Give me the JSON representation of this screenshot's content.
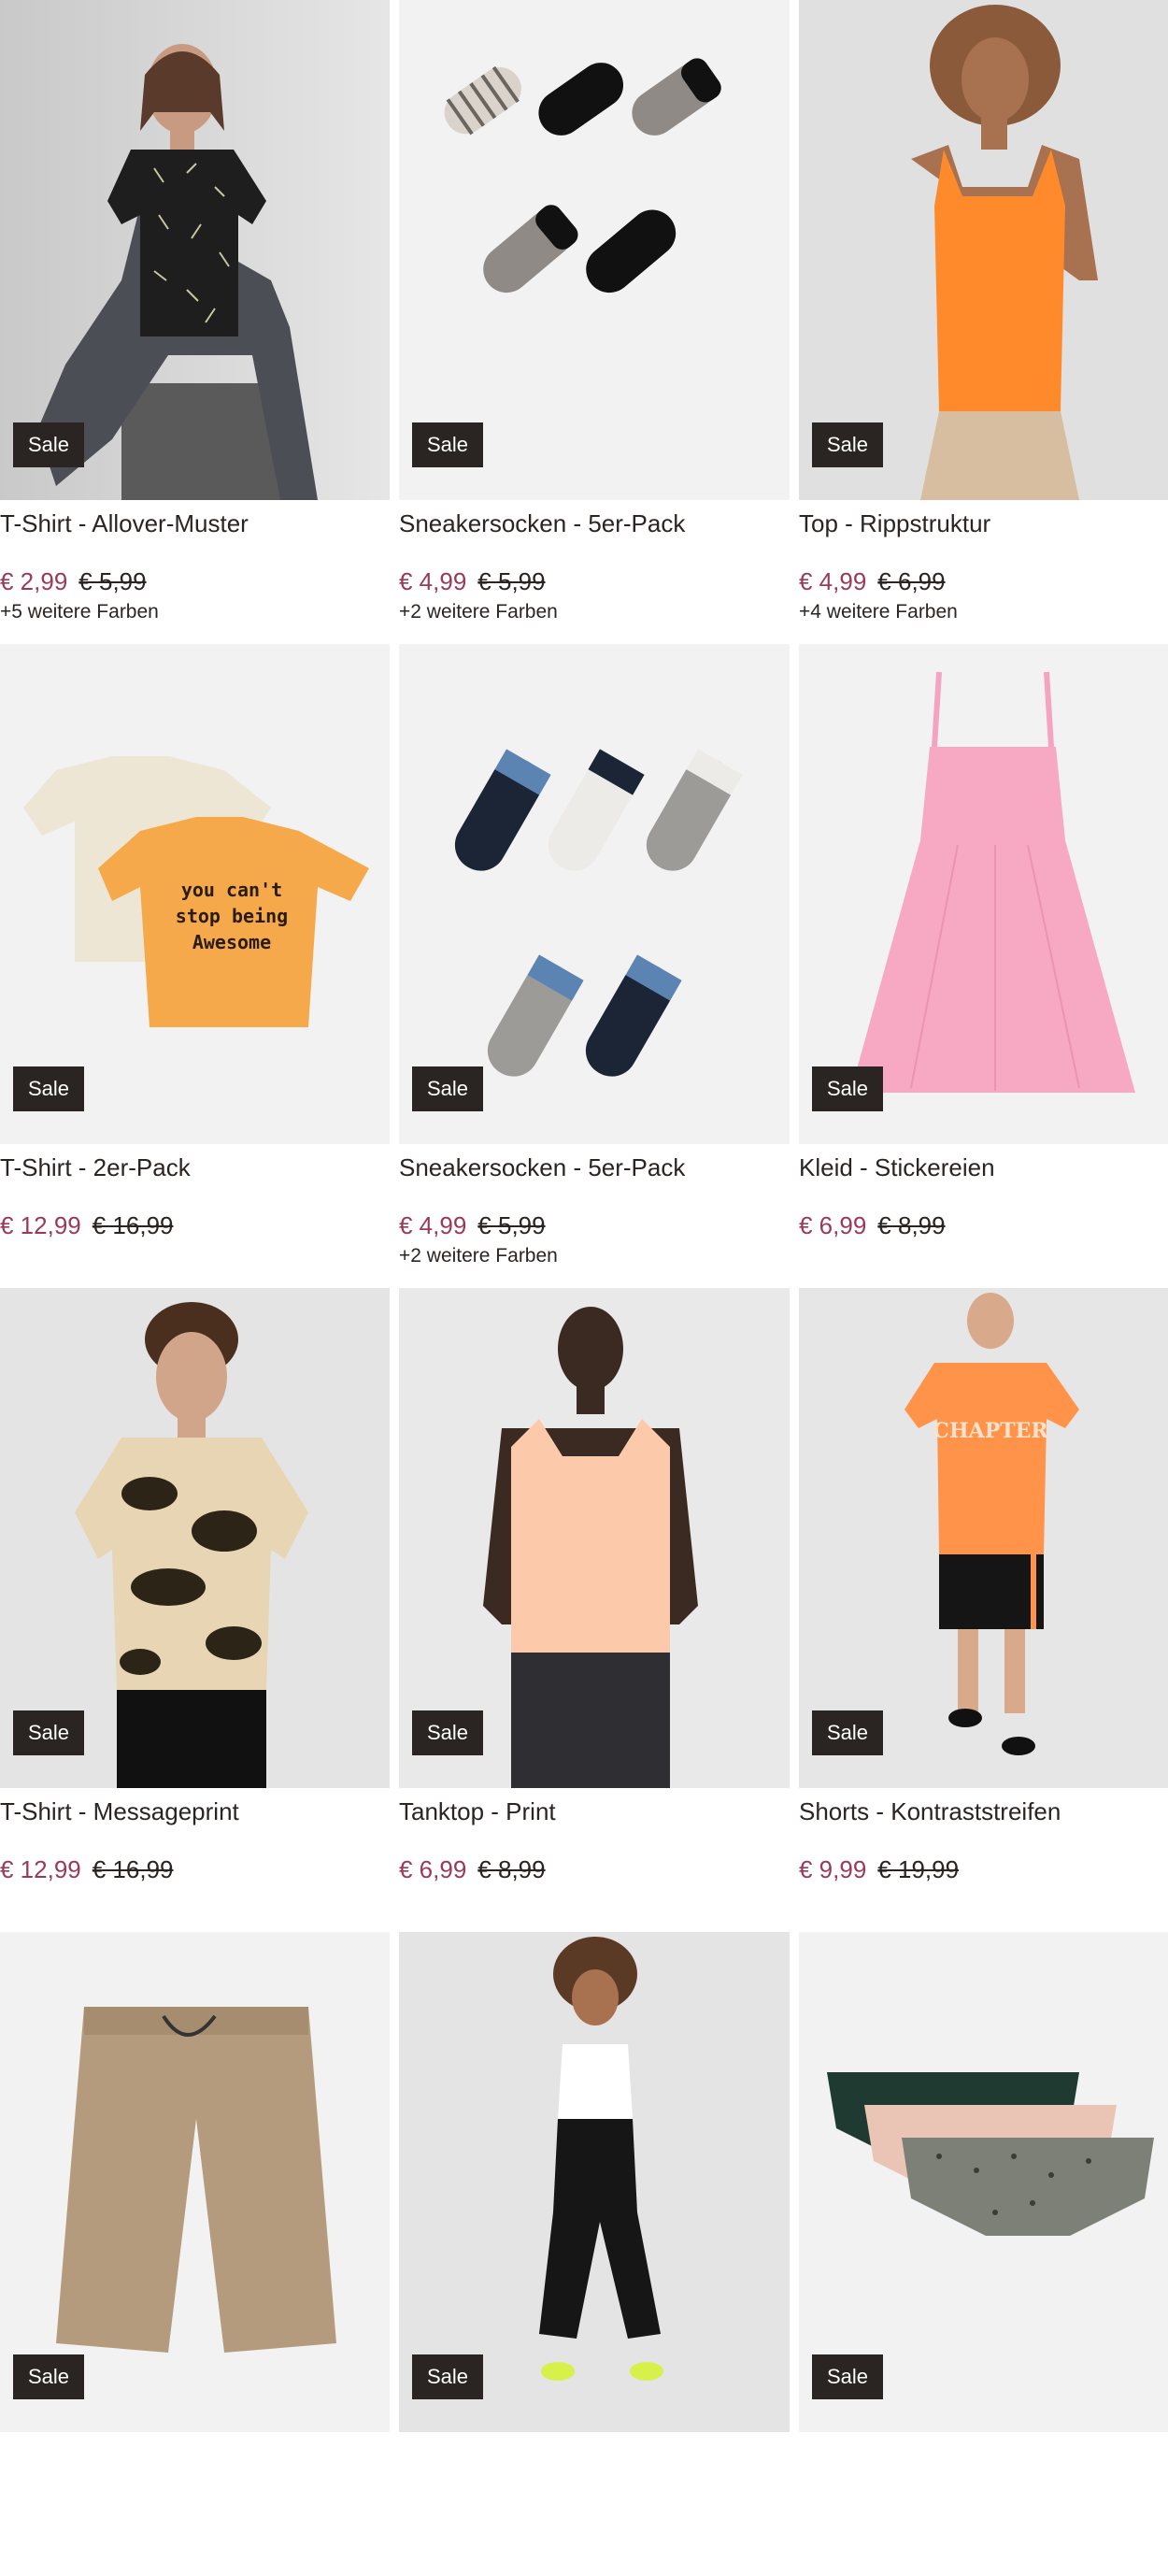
{
  "sale_label": "Sale",
  "products": [
    {
      "title": "T-Shirt - Allover-Muster",
      "price": "€ 2,99",
      "old_price": "€ 5,99",
      "colors": "+5 weitere Farben",
      "icon": "tshirt-allover-pattern-photo"
    },
    {
      "title": "Sneakersocken - 5er-Pack",
      "price": "€ 4,99",
      "old_price": "€ 5,99",
      "colors": "+2 weitere Farben",
      "icon": "gaming-socks-photo"
    },
    {
      "title": "Top - Rippstruktur",
      "price": "€ 4,99",
      "old_price": "€ 6,99",
      "colors": "+4 weitere Farben",
      "icon": "orange-top-photo"
    },
    {
      "title": "T-Shirt - 2er-Pack",
      "price": "€ 12,99",
      "old_price": "€ 16,99",
      "colors": "",
      "icon": "tshirt-2pack-photo",
      "print_text": [
        "you can't",
        "stop being",
        "Awesome"
      ]
    },
    {
      "title": "Sneakersocken - 5er-Pack",
      "price": "€ 4,99",
      "old_price": "€ 5,99",
      "colors": "+2 weitere Farben",
      "icon": "basic-socks-photo"
    },
    {
      "title": "Kleid - Stickereien",
      "price": "€ 6,99",
      "old_price": "€ 8,99",
      "colors": "",
      "icon": "pink-dress-photo"
    },
    {
      "title": "T-Shirt - Messageprint",
      "price": "€ 12,99",
      "old_price": "€ 16,99",
      "colors": "",
      "icon": "tiedye-tshirt-photo"
    },
    {
      "title": "Tanktop - Print",
      "price": "€ 6,99",
      "old_price": "€ 8,99",
      "colors": "",
      "icon": "peach-tanktop-photo"
    },
    {
      "title": "Shorts - Kontraststreifen",
      "price": "€ 9,99",
      "old_price": "€ 19,99",
      "colors": "",
      "icon": "shorts-chapter-shirt-photo",
      "print_text": [
        "CHAPTER"
      ]
    },
    {
      "title": "",
      "price": "",
      "old_price": "",
      "colors": "",
      "icon": "beige-shorts-photo"
    },
    {
      "title": "",
      "price": "",
      "old_price": "",
      "colors": "",
      "icon": "capri-leggings-photo"
    },
    {
      "title": "",
      "price": "",
      "old_price": "",
      "colors": "",
      "icon": "briefs-3pack-photo"
    }
  ]
}
